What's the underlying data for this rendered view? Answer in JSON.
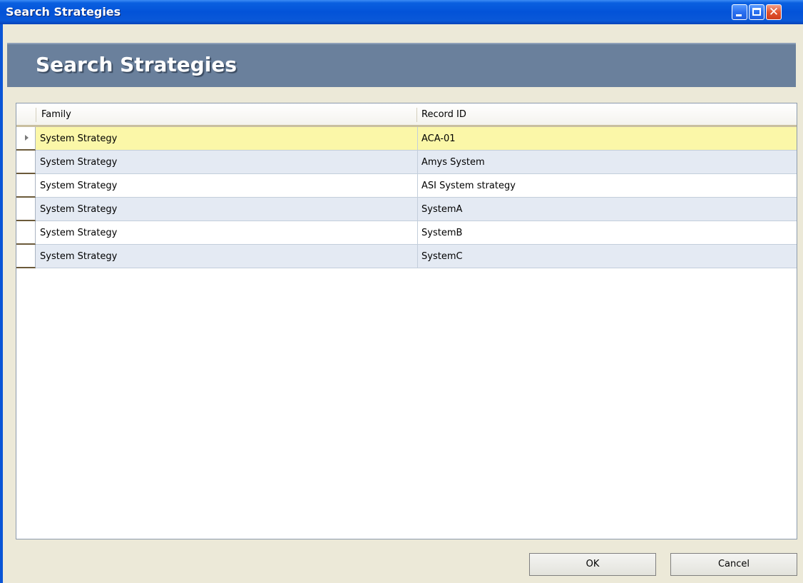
{
  "window": {
    "title": "Search Strategies"
  },
  "header": {
    "title": "Search Strategies"
  },
  "grid": {
    "columns": [
      "Family",
      "Record ID"
    ],
    "rows": [
      {
        "family": "System Strategy",
        "record_id": "ACA-01",
        "selected": true
      },
      {
        "family": "System Strategy",
        "record_id": "Amys System"
      },
      {
        "family": "System Strategy",
        "record_id": "ASI System strategy"
      },
      {
        "family": "System Strategy",
        "record_id": "SystemA"
      },
      {
        "family": "System Strategy",
        "record_id": "SystemB"
      },
      {
        "family": "System Strategy",
        "record_id": "SystemC"
      }
    ]
  },
  "buttons": {
    "ok": "OK",
    "cancel": "Cancel"
  },
  "icons": {
    "minimize": "minimize-icon",
    "maximize": "maximize-icon",
    "close": "close-icon",
    "row_indicator": "row-pointer-icon"
  },
  "colors": {
    "titlebar": "#0353d8",
    "header_band": "#6a809c",
    "selected_row": "#fbf7a8",
    "alt_row": "#e4eaf3"
  }
}
